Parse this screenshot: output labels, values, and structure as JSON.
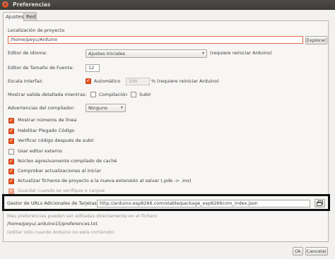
{
  "window": {
    "title": "Preferencias",
    "close_glyph": "×"
  },
  "tabs": [
    {
      "label": "Ajustes",
      "active": true
    },
    {
      "label": "Red",
      "active": false
    }
  ],
  "sketchbook": {
    "label": "Localización de proyecto",
    "value": "/home/peyu/Arduino",
    "browse_label": "Explorar"
  },
  "language": {
    "label": "Editor de idioma:",
    "value": "Ajustes Iniciales",
    "note": "(requiere reiniciar Arduino)"
  },
  "font_size": {
    "label": "Editor de Tamaño de Fuente:",
    "value": "12"
  },
  "scale": {
    "label": "Escala Interfaz:",
    "auto_label": "Automático",
    "auto_checked": true,
    "percent_value": "100",
    "percent_sign": "%",
    "note": "(requiere reiniciar Arduino)"
  },
  "verbose": {
    "label": "Mostrar salida detallada mientras:",
    "compile_label": "Compilación",
    "upload_label": "Subir"
  },
  "warnings": {
    "label": "Advertencias del compilador:",
    "value": "Ninguno"
  },
  "options": [
    {
      "label": "Mostrar números de línea",
      "checked": true
    },
    {
      "label": "Habilitar Plegado Código",
      "checked": true
    },
    {
      "label": "Verificar código después de subir",
      "checked": true
    },
    {
      "label": "Usar editor externo",
      "checked": false
    },
    {
      "label": "Núcleo agresivamente compilado de caché",
      "checked": true
    },
    {
      "label": "Comprobar actualizaciones al iniciar",
      "checked": true
    },
    {
      "label": "Actualizar ficheros de proyecto a la nueva extensión al salvar (.pde -> .ino)",
      "checked": true
    },
    {
      "label": "Guardar cuando se verifique o cargue",
      "checked": true,
      "disabled": true
    }
  ],
  "board_urls": {
    "label": "Gestor de URLs Adicionales de Tarjetas:",
    "value": "http://arduino.esp8266.com/stable/package_esp8266com_index.json"
  },
  "footer": {
    "info": "Más preferencias pueden ser editadas directamente en el fichero",
    "path": "/home/peyu/.arduino15/preferences.txt",
    "note": "(editar sólo cuando Arduino no está corriendo)"
  },
  "buttons": {
    "ok": "Ok",
    "cancel": "Cancelar"
  },
  "colors": {
    "accent": "#e95420",
    "titlebar": "#3c3b37",
    "highlight_border": "#111111"
  }
}
